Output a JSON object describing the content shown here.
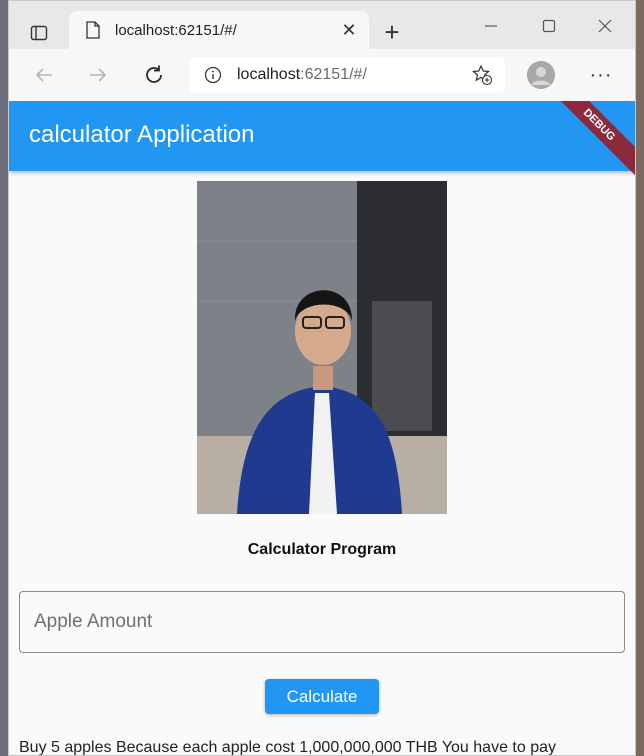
{
  "browser": {
    "tab_title": "localhost:62151/#/",
    "url_host": "localhost",
    "url_rest": ":62151/#/",
    "new_tab_label": "+",
    "menu_label": "···"
  },
  "app": {
    "title": "calculator Application",
    "debug_banner": "DEBUG",
    "heading": "Calculator Program",
    "input_placeholder": "Apple Amount",
    "button_label": "Calculate",
    "result_text": "Buy 5 apples Because each apple cost 1,000,000,000 THB You have to pay"
  },
  "colors": {
    "accent": "#2196f3",
    "debug": "#8b2a3d"
  }
}
